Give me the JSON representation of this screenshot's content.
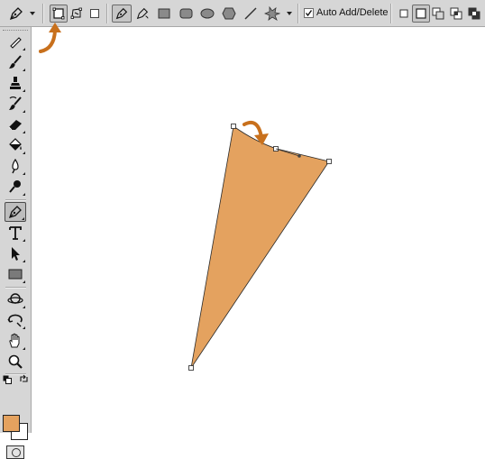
{
  "options_bar": {
    "tool_preset": "pen-icon",
    "mode_buttons": [
      "shape-layers-icon",
      "paths-icon",
      "fill-pixels-icon"
    ],
    "selected_mode": "paths",
    "draw_tools": [
      "pen-icon",
      "freeform-pen-icon",
      "rectangle-icon",
      "rounded-rectangle-icon",
      "ellipse-icon",
      "polygon-icon",
      "line-icon",
      "custom-shape-icon"
    ],
    "auto_add_delete_label": "Auto Add/Delete",
    "auto_add_delete_checked": true,
    "path_operations": [
      "add-to-area-icon",
      "subtract-from-area-icon",
      "intersect-areas-icon",
      "exclude-overlap-icon"
    ]
  },
  "tools_panel": {
    "tools": [
      "spot-healing-brush-icon",
      "brush-icon",
      "clone-stamp-icon",
      "history-brush-icon",
      "eraser-icon",
      "paint-bucket-icon",
      "blur-icon",
      "dodge-icon",
      "pen-icon",
      "type-icon",
      "path-selection-icon",
      "rectangle-icon",
      "3d-rotate-icon",
      "3d-orbit-icon",
      "hand-icon",
      "zoom-icon"
    ],
    "active_tool": "pen-icon",
    "foreground_color": "#e4a25f",
    "background_color": "#ffffff"
  },
  "canvas": {
    "shape_fill": "#e4a25f",
    "annotation_arrow_color": "#c8701c"
  }
}
